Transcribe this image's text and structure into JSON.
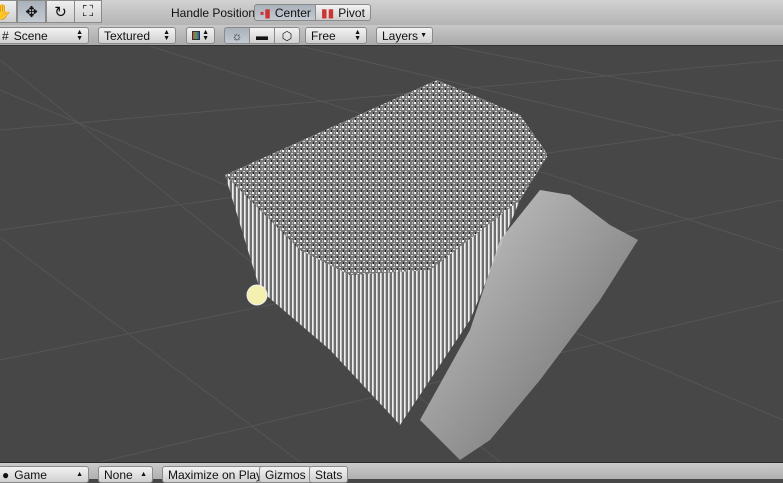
{
  "toolbar": {
    "tools": [
      "hand-tool",
      "move-tool",
      "rotate-tool",
      "scale-tool"
    ],
    "handle_label": "Handle Position:",
    "center": "Center",
    "pivot": "Pivot"
  },
  "scene": {
    "tab": "Scene",
    "render_mode": "Textured",
    "camera": "Free",
    "layers": "Layers"
  },
  "game": {
    "tab": "Game",
    "aspect": "None",
    "maximize": "Maximize on Play",
    "gizmos": "Gizmos",
    "stats": "Stats"
  }
}
